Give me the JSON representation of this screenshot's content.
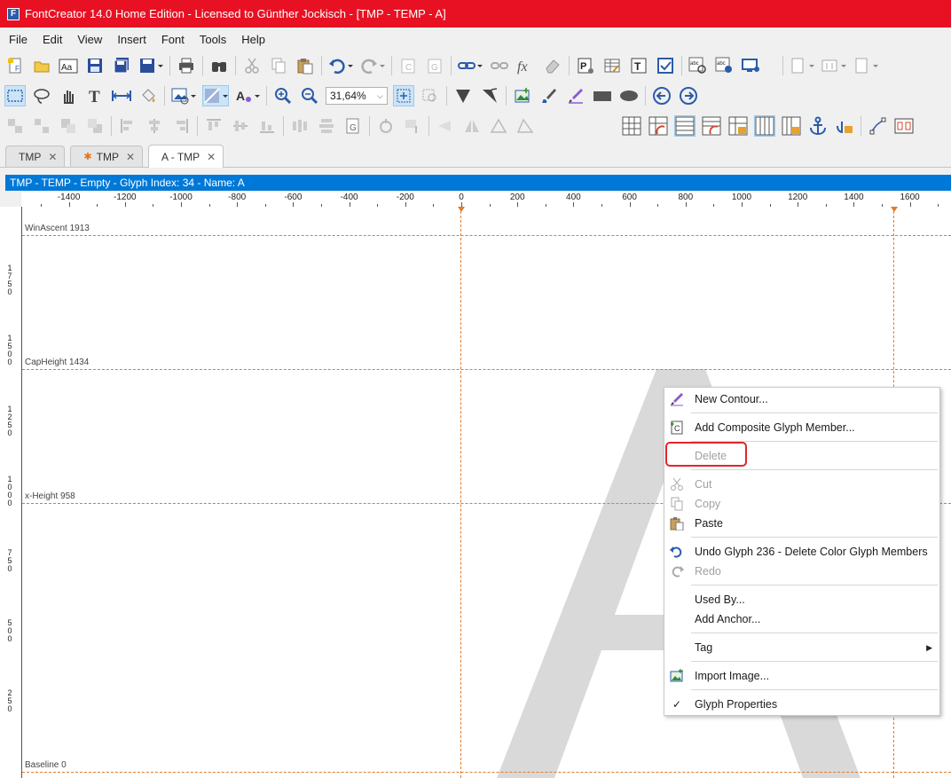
{
  "window": {
    "title": "FontCreator 14.0 Home Edition - Licensed to Günther Jockisch - [TMP - TEMP - A]",
    "logo_letter": "F"
  },
  "menubar": {
    "items": [
      "File",
      "Edit",
      "View",
      "Insert",
      "Font",
      "Tools",
      "Help"
    ]
  },
  "toolbar": {
    "zoom_value": "31,64%"
  },
  "tabs": [
    {
      "label": "TMP",
      "modified": false,
      "active": false
    },
    {
      "label": "TMP",
      "modified": true,
      "active": false
    },
    {
      "label": "A - TMP",
      "modified": false,
      "active": true
    }
  ],
  "glyph_header": "TMP - TEMP - Empty - Glyph Index: 34 - Name: A",
  "ruler": {
    "horizontal": [
      "-1400",
      "-1200",
      "-1000",
      "-800",
      "-600",
      "-400",
      "-200",
      "0",
      "200",
      "400",
      "600",
      "800",
      "1000",
      "1200",
      "1400",
      "1600"
    ],
    "vertical": [
      "1750",
      "1500",
      "1250",
      "1000",
      "750",
      "500",
      "250"
    ]
  },
  "metrics": {
    "win_ascent": "WinAscent 1913",
    "cap_height": "CapHeight 1434",
    "x_height": "x-Height 958",
    "baseline": "Baseline 0"
  },
  "background_glyph": "A",
  "context_menu": {
    "items": [
      {
        "label": "New Contour...",
        "icon": "pen-icon",
        "enabled": true
      },
      {
        "label": "Add Composite Glyph Member...",
        "icon": "composite-icon",
        "enabled": true
      },
      {
        "label": "Delete",
        "icon": "",
        "enabled": false
      },
      {
        "label": "Cut",
        "icon": "scissors-icon",
        "enabled": false
      },
      {
        "label": "Copy",
        "icon": "copy-icon",
        "enabled": false
      },
      {
        "label": "Paste",
        "icon": "paste-icon",
        "enabled": true
      },
      {
        "label": "Undo Glyph 236 - Delete Color Glyph Members",
        "icon": "undo-icon",
        "enabled": true
      },
      {
        "label": "Redo",
        "icon": "redo-icon",
        "enabled": false
      },
      {
        "label": "Used By...",
        "icon": "",
        "enabled": true
      },
      {
        "label": "Add Anchor...",
        "icon": "",
        "enabled": true
      },
      {
        "label": "Tag",
        "icon": "",
        "enabled": true
      },
      {
        "label": "Import Image...",
        "icon": "image-icon",
        "enabled": true
      },
      {
        "label": "Glyph Properties",
        "icon": "checkmark-icon",
        "enabled": true
      }
    ]
  },
  "colors": {
    "titlebar": "#e81123",
    "header_blue": "#0078d7",
    "guideline": "#e07b2a",
    "highlight": "#e0262b"
  }
}
